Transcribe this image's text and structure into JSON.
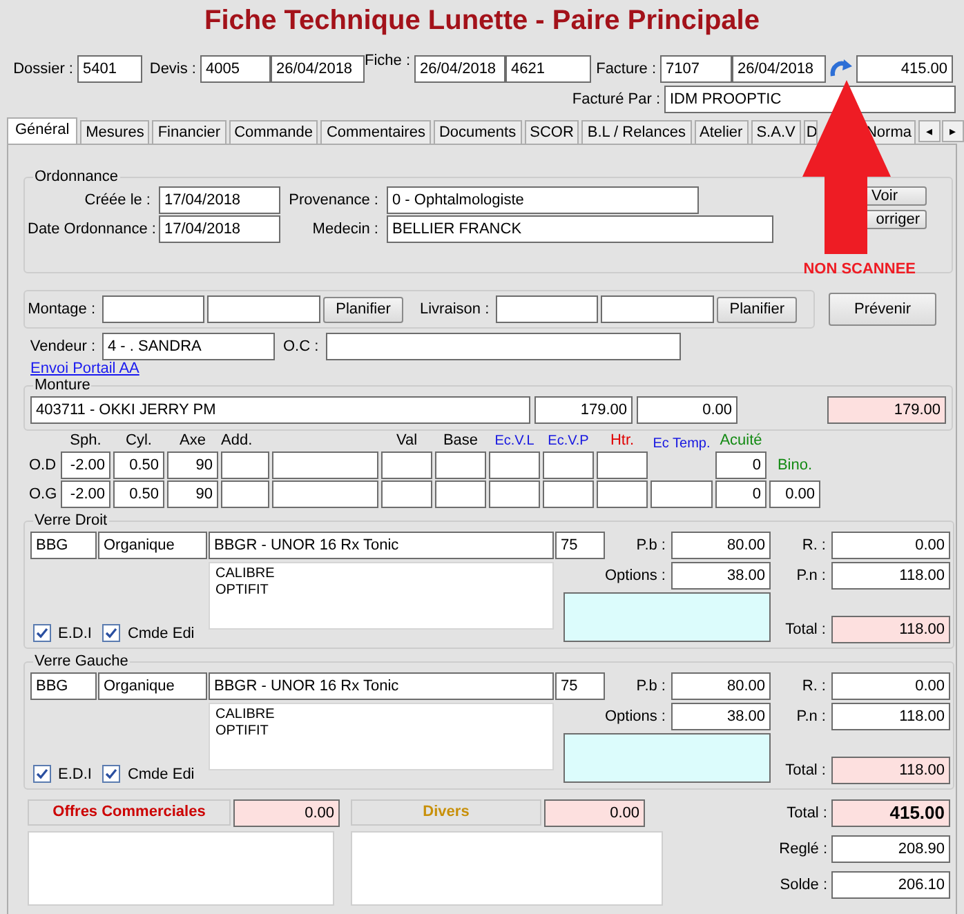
{
  "title": "Fiche Technique Lunette - Paire Principale",
  "header": {
    "dossier": {
      "label": "Dossier :",
      "value": "5401"
    },
    "devis": {
      "label": "Devis :",
      "number": "4005",
      "date": "26/04/2018"
    },
    "fiche": {
      "label": "Fiche :",
      "date": "26/04/2018",
      "number": "4621"
    },
    "facture": {
      "label": "Facture :",
      "number": "7107",
      "date": "26/04/2018",
      "amount": "415.00"
    },
    "facture_par": {
      "label": "Facturé Par :",
      "value": "IDM PROOPTIC"
    }
  },
  "tabs": [
    {
      "label": "Général",
      "selected": true
    },
    {
      "label": "Mesures",
      "selected": false
    },
    {
      "label": "Financier",
      "selected": false
    },
    {
      "label": "Commande",
      "selected": false
    },
    {
      "label": "Commentaires",
      "selected": false
    },
    {
      "label": "Documents",
      "selected": false
    },
    {
      "label": "SCOR",
      "selected": false
    },
    {
      "label": "B.L / Relances",
      "selected": false
    },
    {
      "label": "Atelier",
      "selected": false
    },
    {
      "label": "S.A.V",
      "selected": false
    },
    {
      "label": "D",
      "selected": false
    },
    {
      "label": "Norma",
      "selected": false
    }
  ],
  "tab_scroll": [
    "◂",
    "▸"
  ],
  "ordonnance": {
    "title": "Ordonnance",
    "creee": {
      "label": "Créée le :",
      "value": "17/04/2018"
    },
    "provenance": {
      "label": "Provenance :",
      "value": "0 - Ophtalmologiste"
    },
    "date": {
      "label": "Date Ordonnance :",
      "value": "17/04/2018"
    },
    "medecin": {
      "label": "Medecin :",
      "value": "BELLIER FRANCK"
    },
    "buttons": [
      "Voir",
      "orriger"
    ],
    "scan_status": "NON SCANNEE"
  },
  "montage": {
    "label": "Montage :",
    "button": "Planifier"
  },
  "livraison": {
    "label": "Livraison :",
    "button": "Planifier"
  },
  "prevenir": "Prévenir",
  "vendeur": {
    "label": "Vendeur :",
    "value": "4 - . SANDRA"
  },
  "oc": {
    "label": "O.C :"
  },
  "link": "Envoi Portail AA",
  "monture": {
    "title": "Monture",
    "name": "403711 - OKKI JERRY PM",
    "price": "179.00",
    "discount": "0.00",
    "total": "179.00"
  },
  "measures": {
    "headers": [
      {
        "text": "Sph.",
        "color": "#000000",
        "kind": "top"
      },
      {
        "text": "Cyl.",
        "color": "#000000",
        "kind": "top"
      },
      {
        "text": "Axe",
        "color": "#000000",
        "kind": "top"
      },
      {
        "text": "Add.",
        "color": "#000000",
        "kind": "top"
      },
      {
        "kind": "blank"
      },
      {
        "text": "Val",
        "color": "#000000",
        "kind": "top"
      },
      {
        "text": "Base",
        "color": "#000000",
        "kind": "top"
      },
      {
        "text": "Ec.V.L",
        "color": "#1515e0",
        "kind": "top"
      },
      {
        "text": "Ec.V.P",
        "color": "#1515e0",
        "kind": "top"
      },
      {
        "text": "Htr.",
        "color": "#e00000",
        "kind": "top"
      },
      {
        "text": "Ec Temp.",
        "color": "#1515e0",
        "kind": "tall"
      },
      {
        "text": "Acuité",
        "color": "#138a13",
        "kind": "top"
      },
      {
        "text": "Bino.",
        "color": "#138a13",
        "kind": "inline"
      }
    ],
    "rows": [
      {
        "label": "O.D",
        "cells": [
          "-2.00",
          "0.50",
          "90",
          "",
          "",
          "",
          "",
          "",
          "",
          "",
          "",
          "0",
          ""
        ]
      },
      {
        "label": "O.G",
        "cells": [
          "-2.00",
          "0.50",
          "90",
          "",
          "",
          "",
          "",
          "",
          "",
          "",
          "",
          "0",
          "0.00"
        ]
      }
    ]
  },
  "verres": [
    {
      "title": "Verre Droit",
      "brand": "BBG",
      "material": "Organique",
      "lens": "BBGR - UNOR 16 Rx Tonic",
      "diameter": "75",
      "notes": [
        "CALIBRE",
        "OPTIFIT"
      ],
      "pb": {
        "label": "P.b :",
        "value": "80.00"
      },
      "options": {
        "label": "Options :",
        "value": "38.00"
      },
      "r": {
        "label": "R. :",
        "value": "0.00"
      },
      "pn": {
        "label": "P.n :",
        "value": "118.00"
      },
      "total": {
        "label": "Total :",
        "value": "118.00"
      },
      "checks": [
        {
          "label": "E.D.I",
          "checked": true
        },
        {
          "label": "Cmde Edi",
          "checked": true
        }
      ]
    },
    {
      "title": "Verre Gauche",
      "brand": "BBG",
      "material": "Organique",
      "lens": "BBGR - UNOR 16 Rx Tonic",
      "diameter": "75",
      "notes": [
        "CALIBRE",
        "OPTIFIT"
      ],
      "pb": {
        "label": "P.b :",
        "value": "80.00"
      },
      "options": {
        "label": "Options :",
        "value": "38.00"
      },
      "r": {
        "label": "R. :",
        "value": "0.00"
      },
      "pn": {
        "label": "P.n :",
        "value": "118.00"
      },
      "total": {
        "label": "Total :",
        "value": "118.00"
      },
      "checks": [
        {
          "label": "E.D.I",
          "checked": true
        },
        {
          "label": "Cmde Edi",
          "checked": true
        }
      ]
    }
  ],
  "offres": {
    "label": "Offres Commerciales",
    "value": "0.00"
  },
  "divers": {
    "label": "Divers",
    "value": "0.00"
  },
  "totals": [
    {
      "label": "Total :",
      "value": "415.00",
      "kind": "grand"
    },
    {
      "label": "Reglé :",
      "value": "208.90",
      "kind": "plain"
    },
    {
      "label": "Solde :",
      "value": "206.10",
      "kind": "plain"
    }
  ]
}
